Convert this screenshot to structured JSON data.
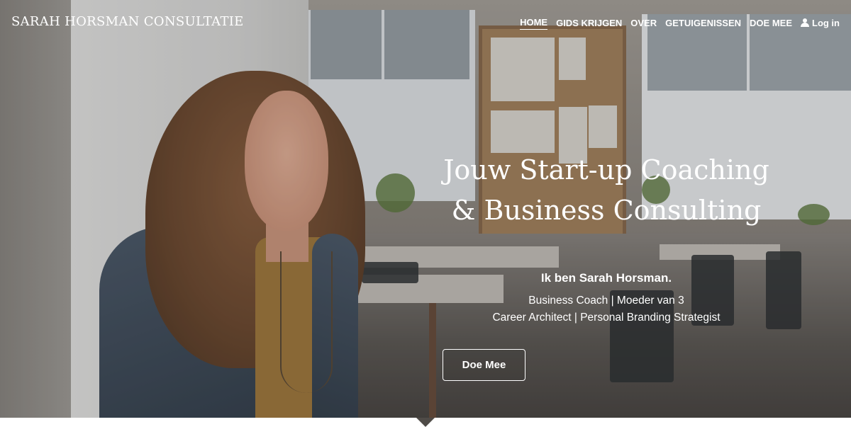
{
  "brand": {
    "name": "SARAH HORSMAN CONSULTATIE"
  },
  "nav": {
    "items": [
      {
        "label": "HOME",
        "active": true
      },
      {
        "label": "GIDS KRIJGEN",
        "active": false
      },
      {
        "label": "OVER",
        "active": false
      },
      {
        "label": "GETUIGENISSEN",
        "active": false
      },
      {
        "label": "DOE MEE",
        "active": false
      }
    ],
    "login_label": "Log in",
    "login_icon": "user-icon"
  },
  "hero": {
    "title_line1": "Jouw Start-up Coaching",
    "title_line2": "& Business Consulting",
    "intro_name": "Ik ben Sarah Horsman.",
    "intro_line1": "Business Coach | Moeder van 3",
    "intro_line2": "Career Architect | Personal Branding Strategist",
    "cta_label": "Doe Mee",
    "text_color": "#ffffff"
  }
}
